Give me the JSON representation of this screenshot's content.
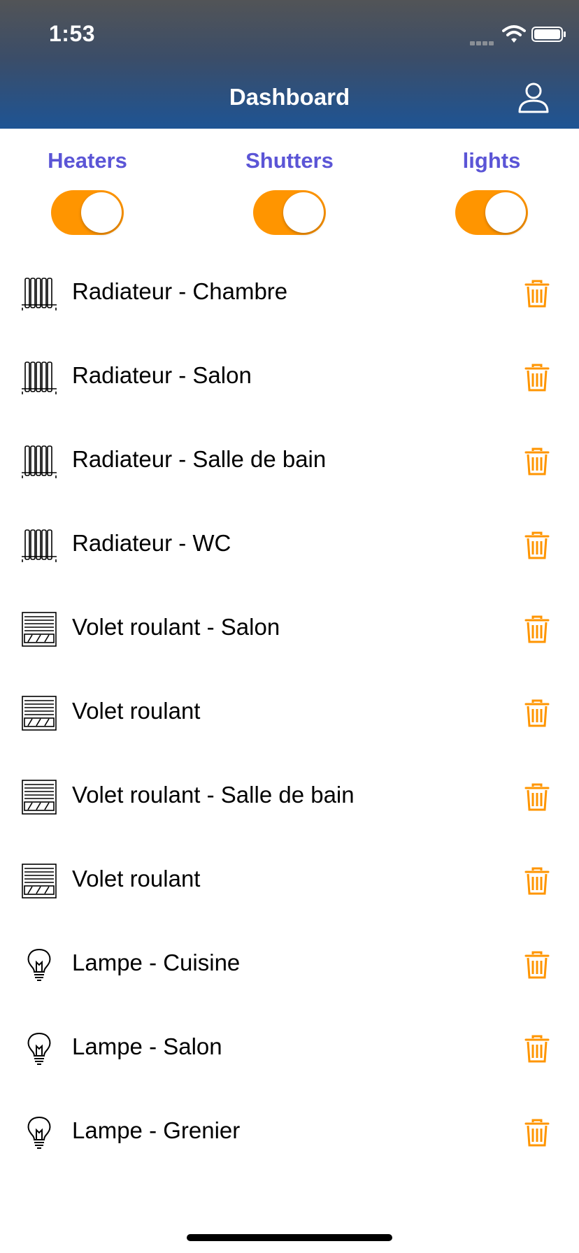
{
  "status_bar": {
    "time": "1:53"
  },
  "header": {
    "title": "Dashboard",
    "profile_icon": "person-icon"
  },
  "categories": [
    {
      "label": "Heaters",
      "enabled": true
    },
    {
      "label": "Shutters",
      "enabled": true
    },
    {
      "label": "lights",
      "enabled": true
    }
  ],
  "colors": {
    "accent": "#ff9500",
    "category_label": "#5b55d6",
    "header_bottom": "#1e5494"
  },
  "devices": [
    {
      "label": "Radiateur - Chambre",
      "icon": "radiator-icon"
    },
    {
      "label": "Radiateur - Salon",
      "icon": "radiator-icon"
    },
    {
      "label": "Radiateur - Salle de bain",
      "icon": "radiator-icon"
    },
    {
      "label": "Radiateur - WC",
      "icon": "radiator-icon"
    },
    {
      "label": "Volet roulant - Salon",
      "icon": "shutter-icon"
    },
    {
      "label": "Volet roulant",
      "icon": "shutter-icon"
    },
    {
      "label": "Volet roulant - Salle de bain",
      "icon": "shutter-icon"
    },
    {
      "label": "Volet roulant",
      "icon": "shutter-icon"
    },
    {
      "label": "Lampe - Cuisine",
      "icon": "lightbulb-icon"
    },
    {
      "label": "Lampe - Salon",
      "icon": "lightbulb-icon"
    },
    {
      "label": "Lampe - Grenier",
      "icon": "lightbulb-icon"
    }
  ]
}
